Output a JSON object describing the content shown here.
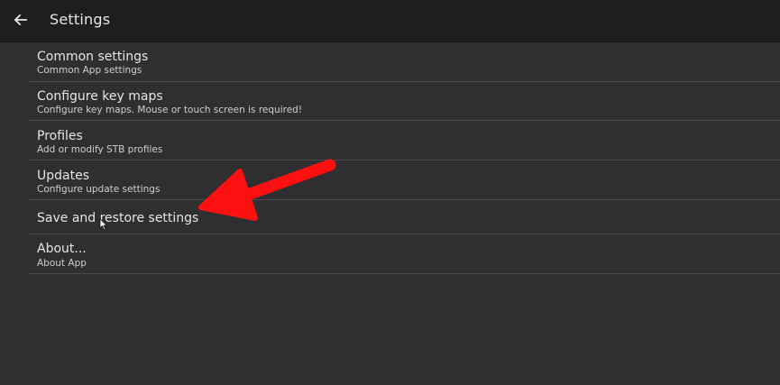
{
  "header": {
    "title": "Settings"
  },
  "icons": {
    "back": "arrow-left-icon",
    "annotation": "red-arrow-annotation",
    "cursor": "mouse-pointer-icon"
  },
  "colors": {
    "topbar": "#1e1e20",
    "background": "#2f2f31",
    "divider": "#4a4a4c",
    "annotation": "#ff1010"
  },
  "settings": {
    "items": [
      {
        "title": "Common settings",
        "subtitle": "Common App settings"
      },
      {
        "title": "Configure key maps",
        "subtitle": "Configure key maps. Mouse or touch screen is required!"
      },
      {
        "title": "Profiles",
        "subtitle": "Add or modify STB profiles"
      },
      {
        "title": "Updates",
        "subtitle": "Configure update settings"
      },
      {
        "title": "Save and restore settings",
        "subtitle": ""
      },
      {
        "title": "About...",
        "subtitle": "About App"
      }
    ]
  }
}
